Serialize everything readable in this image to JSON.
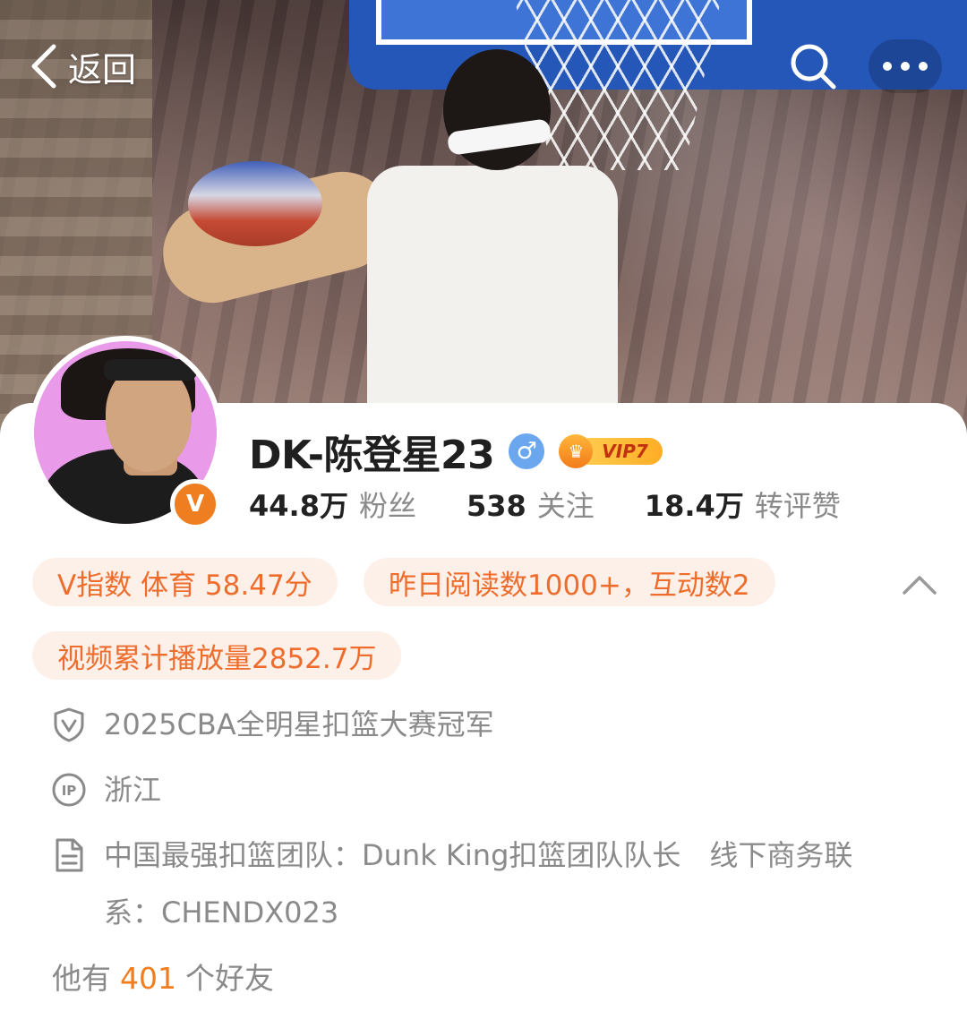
{
  "nav": {
    "back_label": "返回"
  },
  "profile": {
    "username": "DK-陈登星23",
    "gender_symbol": "♂",
    "vip_label": "VIP7",
    "verified_badge_symbol": "V"
  },
  "stats": [
    {
      "value": "44.8万",
      "label": "粉丝"
    },
    {
      "value": "538",
      "label": "关注"
    },
    {
      "value": "18.4万",
      "label": "转评赞"
    }
  ],
  "chips": {
    "v_index": "V指数 体育 58.47分",
    "yesterday_reads": "昨日阅读数1000+，互动数2",
    "video_plays": "视频累计播放量2852.7万"
  },
  "info": {
    "verification": "2025CBA全明星扣篮大赛冠军",
    "ip_location": "浙江",
    "bio": "中国最强扣篮团队：Dunk King扣篮团队队长　线下商务联系：CHENDX023"
  },
  "friends": {
    "prefix": "他有",
    "count": "401",
    "suffix": "个好友"
  },
  "colors": {
    "accent_orange": "#ee7e20",
    "chip_bg": "#fdf0e9",
    "chip_text": "#ee6d2c",
    "gender_blue": "#6aa7ee",
    "secondary_text": "#8a8a8a"
  },
  "icons": {
    "back": "chevron-left-icon",
    "search": "search-icon",
    "more": "more-dots-icon",
    "collapse": "chevron-up-icon",
    "verification": "shield-v-icon",
    "ip": "ip-location-icon",
    "bio": "document-icon"
  }
}
